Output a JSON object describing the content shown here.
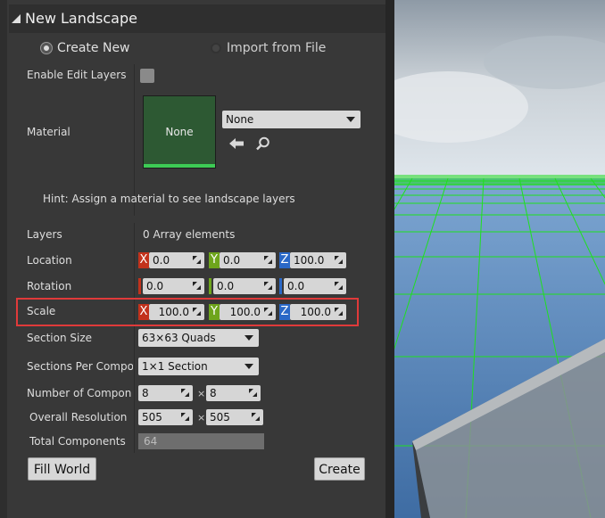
{
  "header": {
    "title": "New Landscape"
  },
  "mode": {
    "create_new": "Create New",
    "import_file": "Import from File"
  },
  "enable_edit_layers": {
    "label": "Enable Edit Layers"
  },
  "material": {
    "label": "Material",
    "thumb_text": "None",
    "dropdown_value": "None"
  },
  "hint": "Hint: Assign a material to see landscape layers",
  "layers": {
    "label": "Layers",
    "value": "0 Array elements"
  },
  "location": {
    "label": "Location",
    "x": "0.0",
    "y": "0.0",
    "z": "100.0",
    "x_axis": "X",
    "y_axis": "Y",
    "z_axis": "Z"
  },
  "rotation": {
    "label": "Rotation",
    "x": "0.0",
    "y": "0.0",
    "z": "0.0"
  },
  "scale": {
    "label": "Scale",
    "x": "100.0",
    "y": "100.0",
    "z": "100.0",
    "x_axis": "X",
    "y_axis": "Y",
    "z_axis": "Z"
  },
  "section_size": {
    "label": "Section Size",
    "value": "63×63 Quads"
  },
  "sections_per_component": {
    "label": "Sections Per Component",
    "value": "1×1 Section"
  },
  "number_of_components": {
    "label": "Number of Components",
    "x": "8",
    "y": "8",
    "times": "×"
  },
  "overall_resolution": {
    "label": "Overall Resolution",
    "x": "505",
    "y": "505",
    "times": "×"
  },
  "total_components": {
    "label": "Total Components",
    "value": "64"
  },
  "buttons": {
    "fill_world": "Fill World",
    "create": "Create"
  },
  "colors": {
    "axis_x": "#c2321c",
    "axis_y": "#6ea51c",
    "axis_z": "#2a68c7",
    "highlight": "#e03a3a",
    "material_green": "#2d5933"
  }
}
